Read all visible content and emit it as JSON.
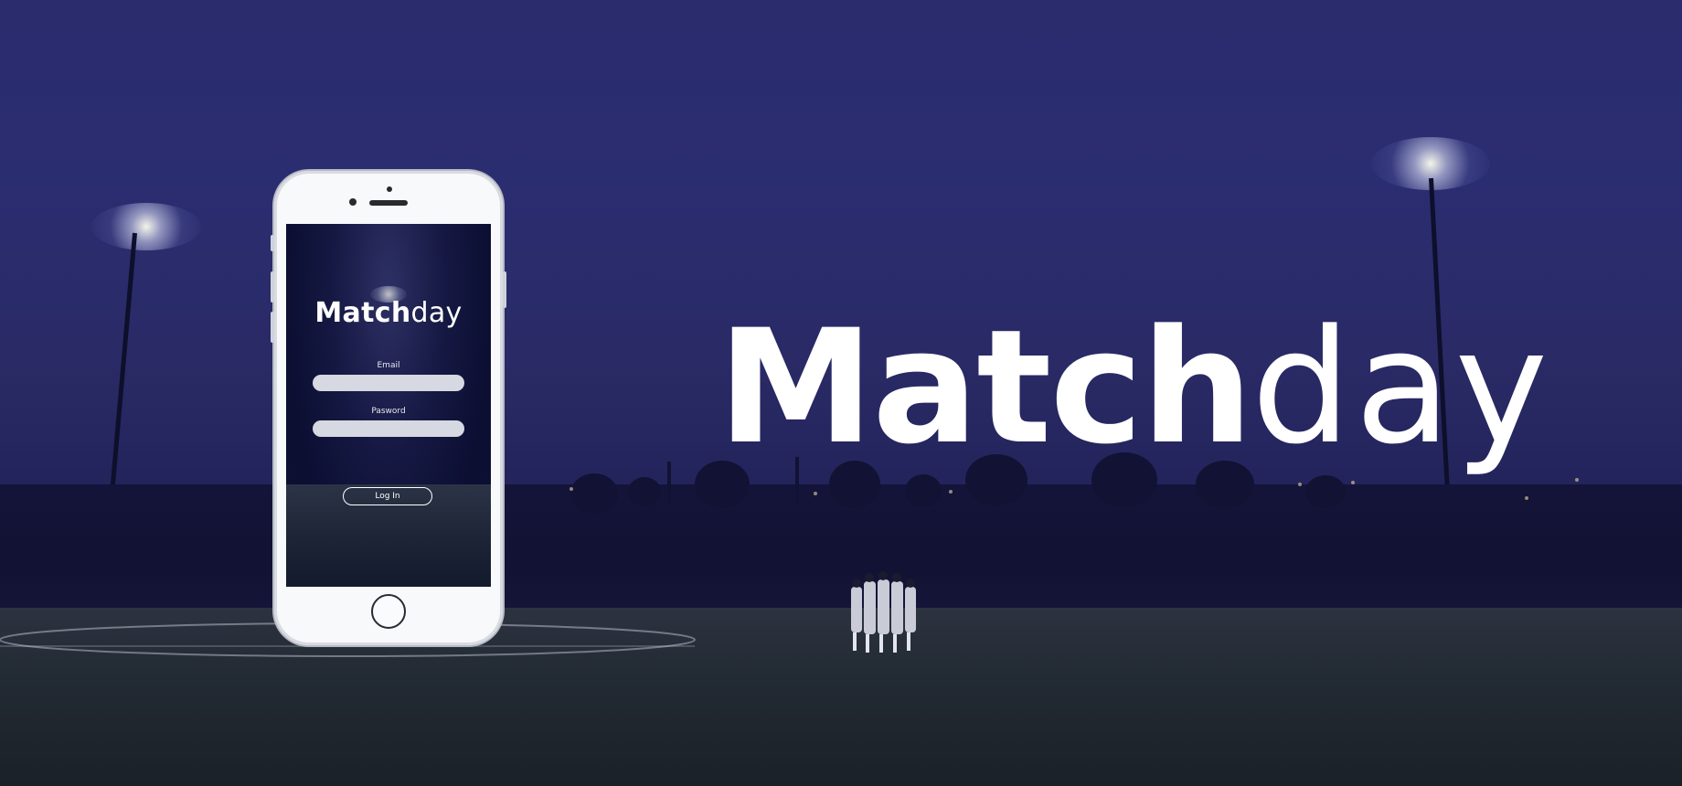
{
  "hero": {
    "title_bold": "Match",
    "title_light": "day"
  },
  "phone": {
    "app_title_bold": "Match",
    "app_title_light": "day",
    "email_label": "Email",
    "password_label": "Pasword",
    "email_value": "",
    "password_value": "",
    "login_label": "Log In"
  },
  "colors": {
    "sky": "#2b2d71",
    "treeline": "#121234",
    "grass": "#222a33",
    "text": "#ffffff"
  }
}
